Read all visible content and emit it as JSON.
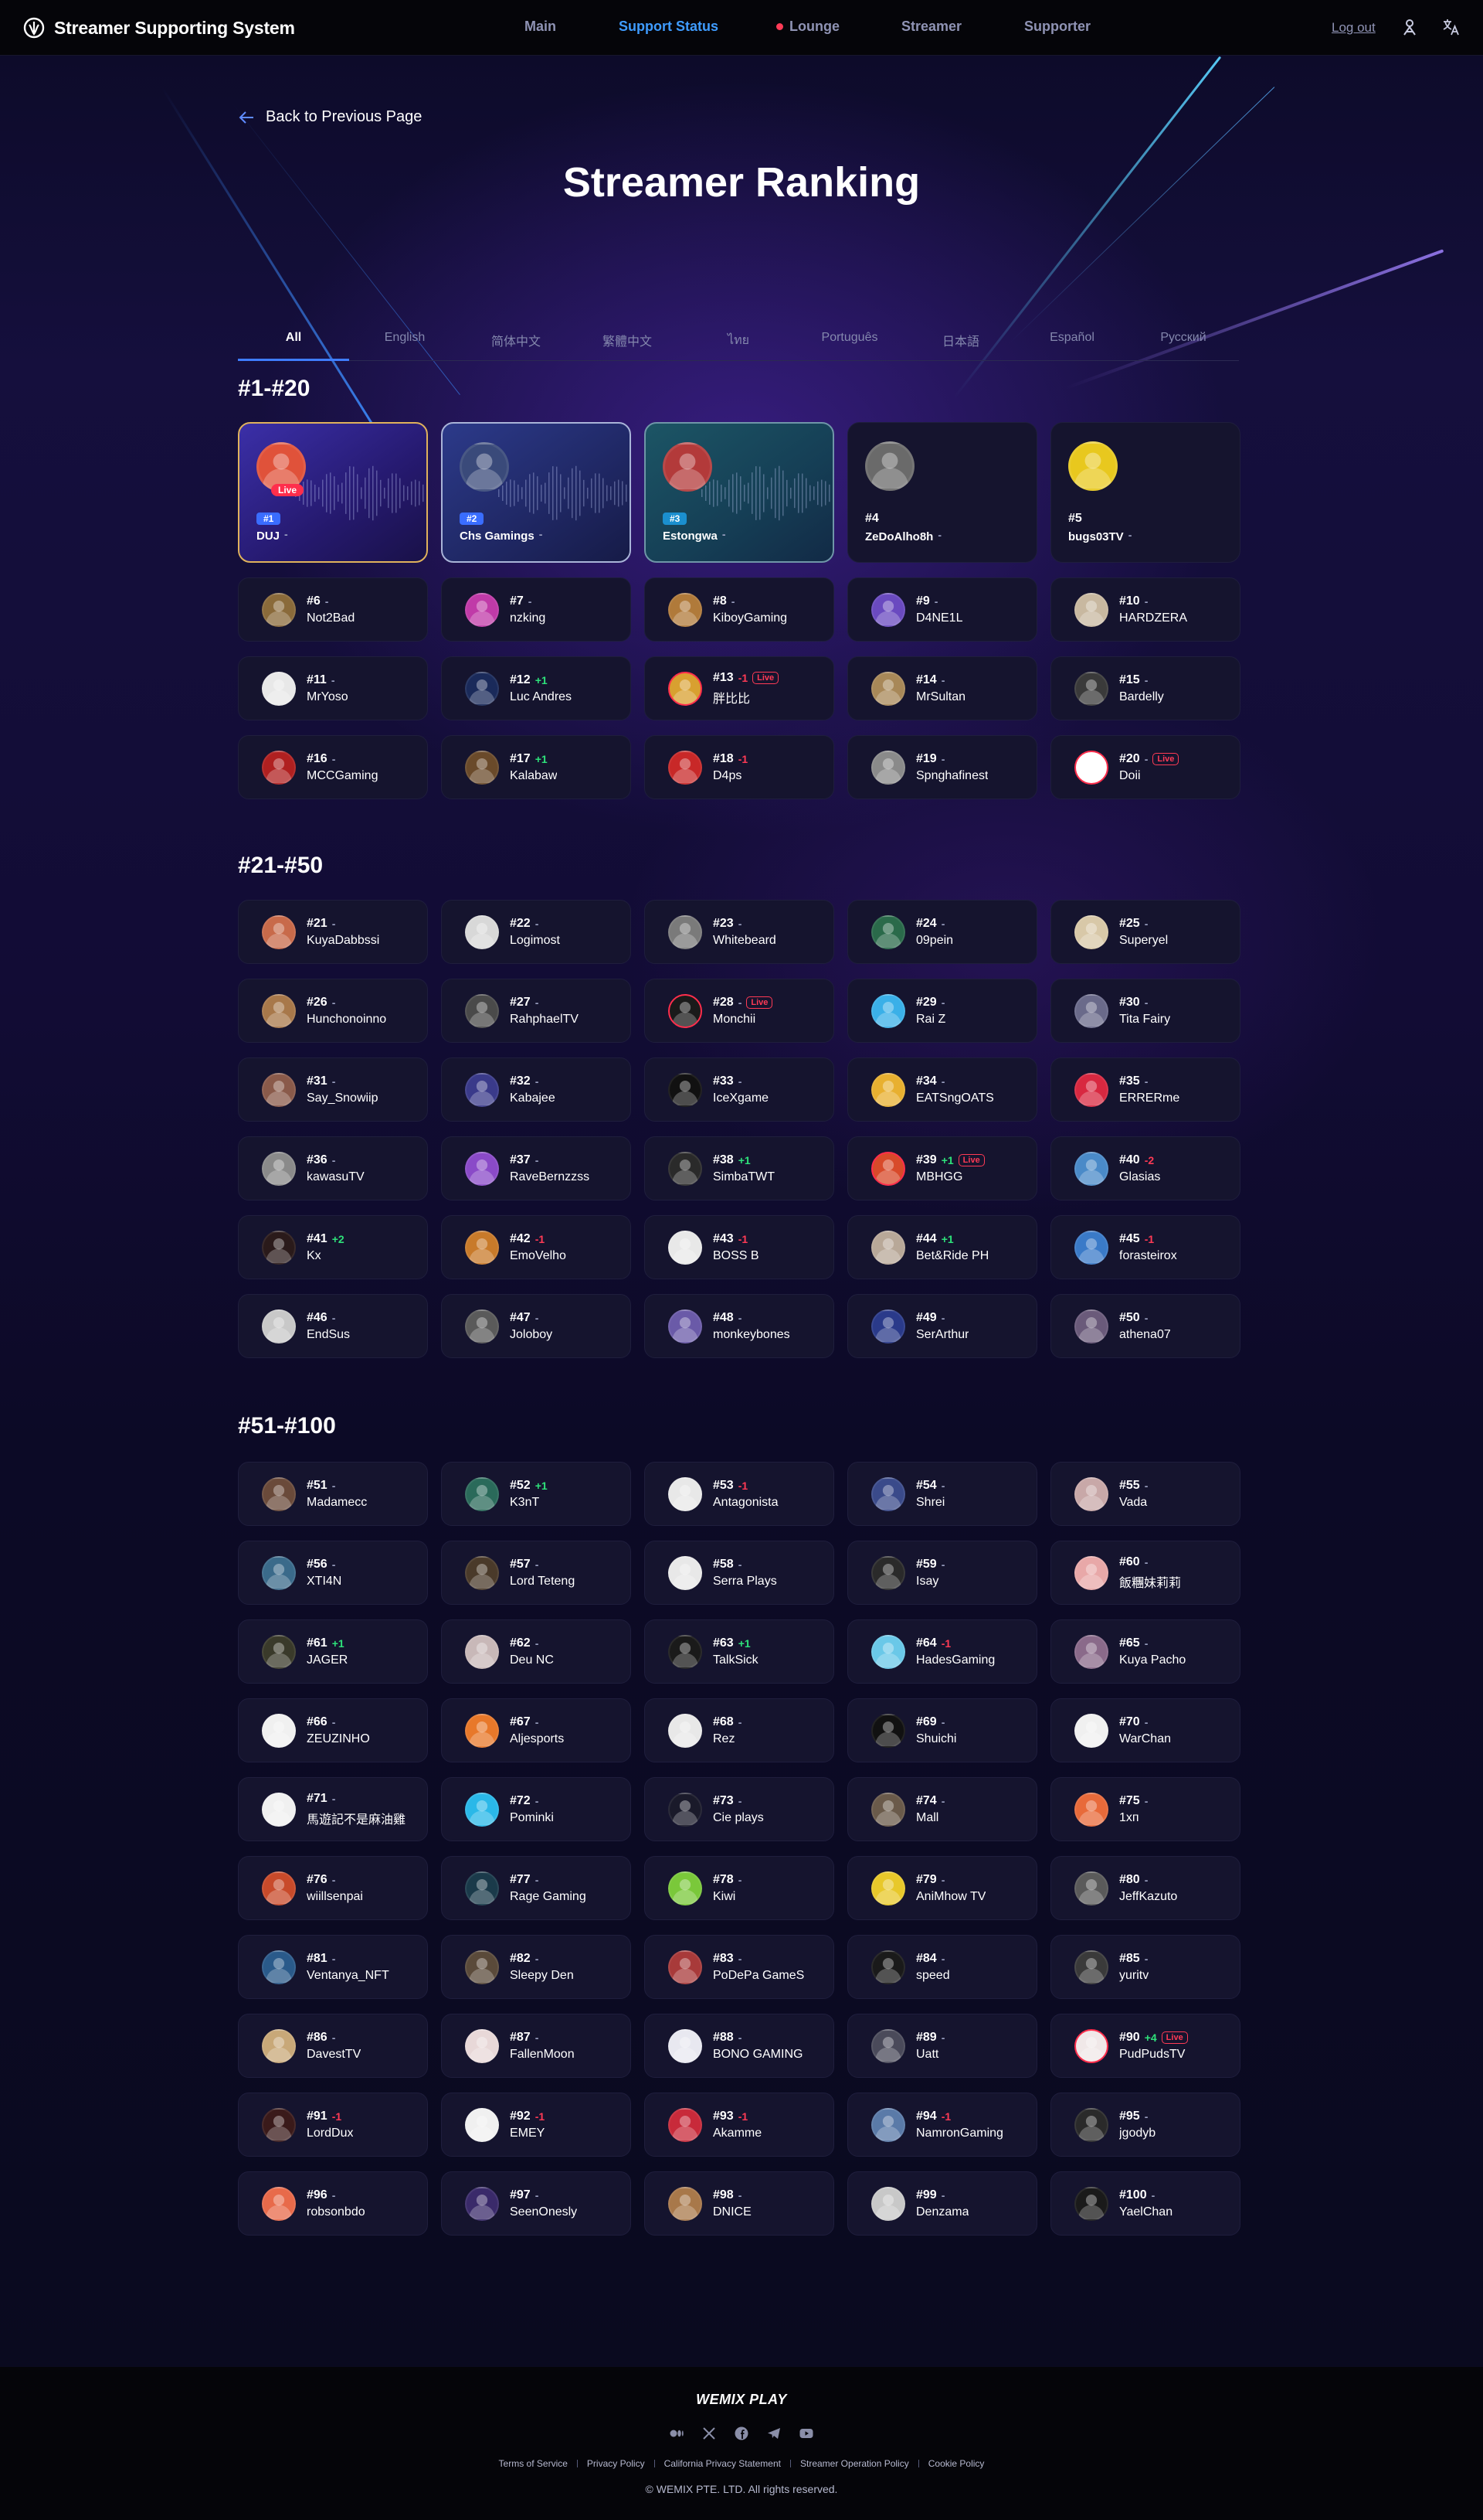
{
  "header": {
    "brand": "Streamer Supporting System",
    "nav": [
      "Main",
      "Support Status",
      "Lounge",
      "Streamer",
      "Supporter"
    ],
    "active_nav": "Support Status",
    "logout": "Log out"
  },
  "back_label": "Back to Previous Page",
  "title": "Streamer Ranking",
  "tabs": [
    "All",
    "English",
    "简体中文",
    "繁體中文",
    "ไทย",
    "Português",
    "日本語",
    "Español",
    "Русский"
  ],
  "active_tab": "All",
  "sections": [
    {
      "title": "#1-#20",
      "entries": [
        {
          "rank": "#1",
          "change": "-",
          "name": "DUJ",
          "live": true,
          "color": "#e0523a"
        },
        {
          "rank": "#2",
          "change": "-",
          "name": "Chs Gamings",
          "live": false,
          "color": "#3a4a7a"
        },
        {
          "rank": "#3",
          "change": "-",
          "name": "Estongwa",
          "live": false,
          "color": "#b33a3a"
        },
        {
          "rank": "#4",
          "change": "-",
          "name": "ZeDoAlho8h",
          "live": false,
          "color": "#6a6a6a"
        },
        {
          "rank": "#5",
          "change": "-",
          "name": "bugs03TV",
          "live": false,
          "color": "#e8c81e"
        },
        {
          "rank": "#6",
          "change": "-",
          "name": "Not2Bad",
          "live": false,
          "color": "#8a6a3a"
        },
        {
          "rank": "#7",
          "change": "-",
          "name": "nzking",
          "live": false,
          "color": "#c03aa8"
        },
        {
          "rank": "#8",
          "change": "-",
          "name": "KiboyGaming",
          "live": false,
          "color": "#b07a3a"
        },
        {
          "rank": "#9",
          "change": "-",
          "name": "D4NE1L",
          "live": false,
          "color": "#6a4ac0"
        },
        {
          "rank": "#10",
          "change": "-",
          "name": "HARDZERA",
          "live": false,
          "color": "#c8b8a0"
        },
        {
          "rank": "#11",
          "change": "-",
          "name": "MrYoso",
          "live": false,
          "color": "#e8e8e8"
        },
        {
          "rank": "#12",
          "change": "+1",
          "name": "Luc Andres",
          "live": false,
          "color": "#1a2a5a"
        },
        {
          "rank": "#13",
          "change": "-1",
          "name": "胖比比",
          "live": true,
          "color": "#d8a030"
        },
        {
          "rank": "#14",
          "change": "-",
          "name": "MrSultan",
          "live": false,
          "color": "#a88858"
        },
        {
          "rank": "#15",
          "change": "-",
          "name": "Bardelly",
          "live": false,
          "color": "#3a3a3a"
        },
        {
          "rank": "#16",
          "change": "-",
          "name": "MCCGaming",
          "live": false,
          "color": "#b02020"
        },
        {
          "rank": "#17",
          "change": "+1",
          "name": "Kalabaw",
          "live": false,
          "color": "#6a4a2a"
        },
        {
          "rank": "#18",
          "change": "-1",
          "name": "D4ps",
          "live": false,
          "color": "#c82828"
        },
        {
          "rank": "#19",
          "change": "-",
          "name": "Spnghafinest",
          "live": false,
          "color": "#8a8a8a"
        },
        {
          "rank": "#20",
          "change": "-",
          "name": "Doii",
          "live": true,
          "color": "#ffffff"
        }
      ]
    },
    {
      "title": "#21-#50",
      "entries": [
        {
          "rank": "#21",
          "change": "-",
          "name": "KuyaDabbssi",
          "live": false,
          "color": "#c86a4a"
        },
        {
          "rank": "#22",
          "change": "-",
          "name": "Logimost",
          "live": false,
          "color": "#d8d8d8"
        },
        {
          "rank": "#23",
          "change": "-",
          "name": "Whitebeard",
          "live": false,
          "color": "#7a7a7a"
        },
        {
          "rank": "#24",
          "change": "-",
          "name": "09pein",
          "live": false,
          "color": "#2a6a4a"
        },
        {
          "rank": "#25",
          "change": "-",
          "name": "Superyel",
          "live": false,
          "color": "#d8c8a8"
        },
        {
          "rank": "#26",
          "change": "-",
          "name": "Hunchonoinno",
          "live": false,
          "color": "#a8784a"
        },
        {
          "rank": "#27",
          "change": "-",
          "name": "RahphaelTV",
          "live": false,
          "color": "#4a4a4a"
        },
        {
          "rank": "#28",
          "change": "-",
          "name": "Monchii",
          "live": true,
          "color": "#1a1a1a"
        },
        {
          "rank": "#29",
          "change": "-",
          "name": "Rai Z",
          "live": false,
          "color": "#3ab0e8"
        },
        {
          "rank": "#30",
          "change": "-",
          "name": "Tita Fairy",
          "live": false,
          "color": "#6a6a8a"
        },
        {
          "rank": "#31",
          "change": "-",
          "name": "Say_Snowiip",
          "live": false,
          "color": "#8a5a4a"
        },
        {
          "rank": "#32",
          "change": "-",
          "name": "Kabajee",
          "live": false,
          "color": "#3a3a8a"
        },
        {
          "rank": "#33",
          "change": "-",
          "name": "IceXgame",
          "live": false,
          "color": "#111111"
        },
        {
          "rank": "#34",
          "change": "-",
          "name": "EATSngOATS",
          "live": false,
          "color": "#e8b030"
        },
        {
          "rank": "#35",
          "change": "-",
          "name": "ERRERme",
          "live": false,
          "color": "#d82840"
        },
        {
          "rank": "#36",
          "change": "-",
          "name": "kawasuTV",
          "live": false,
          "color": "#8a8a8a"
        },
        {
          "rank": "#37",
          "change": "-",
          "name": "RaveBernzzss",
          "live": false,
          "color": "#8a4ac8"
        },
        {
          "rank": "#38",
          "change": "+1",
          "name": "SimbaTWT",
          "live": false,
          "color": "#2a2a2a"
        },
        {
          "rank": "#39",
          "change": "+1",
          "name": "MBHGG",
          "live": true,
          "color": "#d84a2a"
        },
        {
          "rank": "#40",
          "change": "-2",
          "name": "Glasias",
          "live": false,
          "color": "#4a8ac8"
        },
        {
          "rank": "#41",
          "change": "+2",
          "name": "Kx",
          "live": false,
          "color": "#2a1a1a"
        },
        {
          "rank": "#42",
          "change": "-1",
          "name": "EmoVelho",
          "live": false,
          "color": "#c87a2a"
        },
        {
          "rank": "#43",
          "change": "-1",
          "name": "BOSS B",
          "live": false,
          "color": "#e8e8e8"
        },
        {
          "rank": "#44",
          "change": "+1",
          "name": "Bet&Ride PH",
          "live": false,
          "color": "#b8a898"
        },
        {
          "rank": "#45",
          "change": "-1",
          "name": "forasteirox",
          "live": false,
          "color": "#3a7ac8"
        },
        {
          "rank": "#46",
          "change": "-",
          "name": "EndSus",
          "live": false,
          "color": "#c8c8c8"
        },
        {
          "rank": "#47",
          "change": "-",
          "name": "Joloboy",
          "live": false,
          "color": "#5a5a5a"
        },
        {
          "rank": "#48",
          "change": "-",
          "name": "monkeybones",
          "live": false,
          "color": "#6a5aa8"
        },
        {
          "rank": "#49",
          "change": "-",
          "name": "SerArthur",
          "live": false,
          "color": "#2a3a8a"
        },
        {
          "rank": "#50",
          "change": "-",
          "name": "athena07",
          "live": false,
          "color": "#6a5a7a"
        }
      ]
    },
    {
      "title": "#51-#100",
      "entries": [
        {
          "rank": "#51",
          "change": "-",
          "name": "Madamecc",
          "live": false,
          "color": "#6a4a3a"
        },
        {
          "rank": "#52",
          "change": "+1",
          "name": "K3nT",
          "live": false,
          "color": "#2a6a5a"
        },
        {
          "rank": "#53",
          "change": "-1",
          "name": "Antagonista",
          "live": false,
          "color": "#e8e8e8"
        },
        {
          "rank": "#54",
          "change": "-",
          "name": "Shrei",
          "live": false,
          "color": "#3a4a8a"
        },
        {
          "rank": "#55",
          "change": "-",
          "name": "Vada",
          "live": false,
          "color": "#c8a8a8"
        },
        {
          "rank": "#56",
          "change": "-",
          "name": "XTI4N",
          "live": false,
          "color": "#3a6a8a"
        },
        {
          "rank": "#57",
          "change": "-",
          "name": "Lord Teteng",
          "live": false,
          "color": "#4a3a2a"
        },
        {
          "rank": "#58",
          "change": "-",
          "name": "Serra Plays",
          "live": false,
          "color": "#e8e8e8"
        },
        {
          "rank": "#59",
          "change": "-",
          "name": "Isay",
          "live": false,
          "color": "#2a2a2a"
        },
        {
          "rank": "#60",
          "change": "-",
          "name": "飯糰妹莉莉",
          "live": false,
          "color": "#e8a8a8"
        },
        {
          "rank": "#61",
          "change": "+1",
          "name": "JAGER",
          "live": false,
          "color": "#3a3a2a"
        },
        {
          "rank": "#62",
          "change": "-",
          "name": "Deu NC",
          "live": false,
          "color": "#c8b8b8"
        },
        {
          "rank": "#63",
          "change": "+1",
          "name": "TalkSick",
          "live": false,
          "color": "#1a1a1a"
        },
        {
          "rank": "#64",
          "change": "-1",
          "name": "HadesGaming",
          "live": false,
          "color": "#6ac8e8"
        },
        {
          "rank": "#65",
          "change": "-",
          "name": "Kuya Pacho",
          "live": false,
          "color": "#8a6a8a"
        },
        {
          "rank": "#66",
          "change": "-",
          "name": "ZEUZINHO",
          "live": false,
          "color": "#f0f0f0"
        },
        {
          "rank": "#67",
          "change": "-",
          "name": "Aljesports",
          "live": false,
          "color": "#e8782a"
        },
        {
          "rank": "#68",
          "change": "-",
          "name": "Rez",
          "live": false,
          "color": "#e8e8e8"
        },
        {
          "rank": "#69",
          "change": "-",
          "name": "Shuichi",
          "live": false,
          "color": "#111111"
        },
        {
          "rank": "#70",
          "change": "-",
          "name": "WarChan",
          "live": false,
          "color": "#f0f0f0"
        },
        {
          "rank": "#71",
          "change": "-",
          "name": "馬遊記不是麻油雞",
          "live": false,
          "color": "#f0f0f0"
        },
        {
          "rank": "#72",
          "change": "-",
          "name": "Pominki",
          "live": false,
          "color": "#2ab8e8"
        },
        {
          "rank": "#73",
          "change": "-",
          "name": "Cie plays",
          "live": false,
          "color": "#1a1a2a"
        },
        {
          "rank": "#74",
          "change": "-",
          "name": "Mall",
          "live": false,
          "color": "#6a5a4a"
        },
        {
          "rank": "#75",
          "change": "-",
          "name": "1хп",
          "live": false,
          "color": "#e86a3a"
        },
        {
          "rank": "#76",
          "change": "-",
          "name": "wiillsenpai",
          "live": false,
          "color": "#c84a2a"
        },
        {
          "rank": "#77",
          "change": "-",
          "name": "Rage Gaming",
          "live": false,
          "color": "#1a3a4a"
        },
        {
          "rank": "#78",
          "change": "-",
          "name": "Kiwi",
          "live": false,
          "color": "#7ac83a"
        },
        {
          "rank": "#79",
          "change": "-",
          "name": "AniMhow TV",
          "live": false,
          "color": "#e8c82a"
        },
        {
          "rank": "#80",
          "change": "-",
          "name": "JeffKazuto",
          "live": false,
          "color": "#5a5a5a"
        },
        {
          "rank": "#81",
          "change": "-",
          "name": "Ventanya_NFT",
          "live": false,
          "color": "#2a5a8a"
        },
        {
          "rank": "#82",
          "change": "-",
          "name": "Sleepy Den",
          "live": false,
          "color": "#5a4a3a"
        },
        {
          "rank": "#83",
          "change": "-",
          "name": "PoDePa GameS",
          "live": false,
          "color": "#a83a3a"
        },
        {
          "rank": "#84",
          "change": "-",
          "name": "speed",
          "live": false,
          "color": "#1a1a1a"
        },
        {
          "rank": "#85",
          "change": "-",
          "name": "yuritv",
          "live": false,
          "color": "#3a3a3a"
        },
        {
          "rank": "#86",
          "change": "-",
          "name": "DavestTV",
          "live": false,
          "color": "#c8a878"
        },
        {
          "rank": "#87",
          "change": "-",
          "name": "FallenMoon",
          "live": false,
          "color": "#e8d8d8"
        },
        {
          "rank": "#88",
          "change": "-",
          "name": "BONO GAMING",
          "live": false,
          "color": "#e8e8f0"
        },
        {
          "rank": "#89",
          "change": "-",
          "name": "Uatt",
          "live": false,
          "color": "#4a4a5a"
        },
        {
          "rank": "#90",
          "change": "+4",
          "name": "PudPudsTV",
          "live": true,
          "color": "#f0e8e8"
        },
        {
          "rank": "#91",
          "change": "-1",
          "name": "LordDux",
          "live": false,
          "color": "#3a1a1a"
        },
        {
          "rank": "#92",
          "change": "-1",
          "name": "EMEY",
          "live": false,
          "color": "#f0f0f0"
        },
        {
          "rank": "#93",
          "change": "-1",
          "name": "Akamme",
          "live": false,
          "color": "#c82a3a"
        },
        {
          "rank": "#94",
          "change": "-1",
          "name": "NamronGaming",
          "live": false,
          "color": "#5a7aa8"
        },
        {
          "rank": "#95",
          "change": "-",
          "name": "jgodyb",
          "live": false,
          "color": "#2a2a2a"
        },
        {
          "rank": "#96",
          "change": "-",
          "name": "robsonbdo",
          "live": false,
          "color": "#e86a4a"
        },
        {
          "rank": "#97",
          "change": "-",
          "name": "SeenOnesly",
          "live": false,
          "color": "#3a2a6a"
        },
        {
          "rank": "#98",
          "change": "-",
          "name": "DNICE",
          "live": false,
          "color": "#a8784a"
        },
        {
          "rank": "#99",
          "change": "-",
          "name": "Denzama",
          "live": false,
          "color": "#c8c8c8"
        },
        {
          "rank": "#100",
          "change": "-",
          "name": "YaelChan",
          "live": false,
          "color": "#1a1a1a"
        }
      ]
    }
  ],
  "live_label": "Live",
  "footer": {
    "logo": "WEMIX PLAY",
    "socials": [
      "medium-icon",
      "x-icon",
      "facebook-icon",
      "telegram-icon",
      "youtube-icon"
    ],
    "links": [
      "Terms of Service",
      "Privacy Policy",
      "California Privacy Statement",
      "Streamer Operation Policy",
      "Cookie Policy"
    ],
    "copyright": "© WEMIX PTE. LTD. All rights reserved."
  },
  "colors": {
    "accent": "#3f9cff",
    "live": "#ff2e4c",
    "up": "#2ee27a",
    "down": "#ff3a55",
    "card": "#15142e"
  }
}
